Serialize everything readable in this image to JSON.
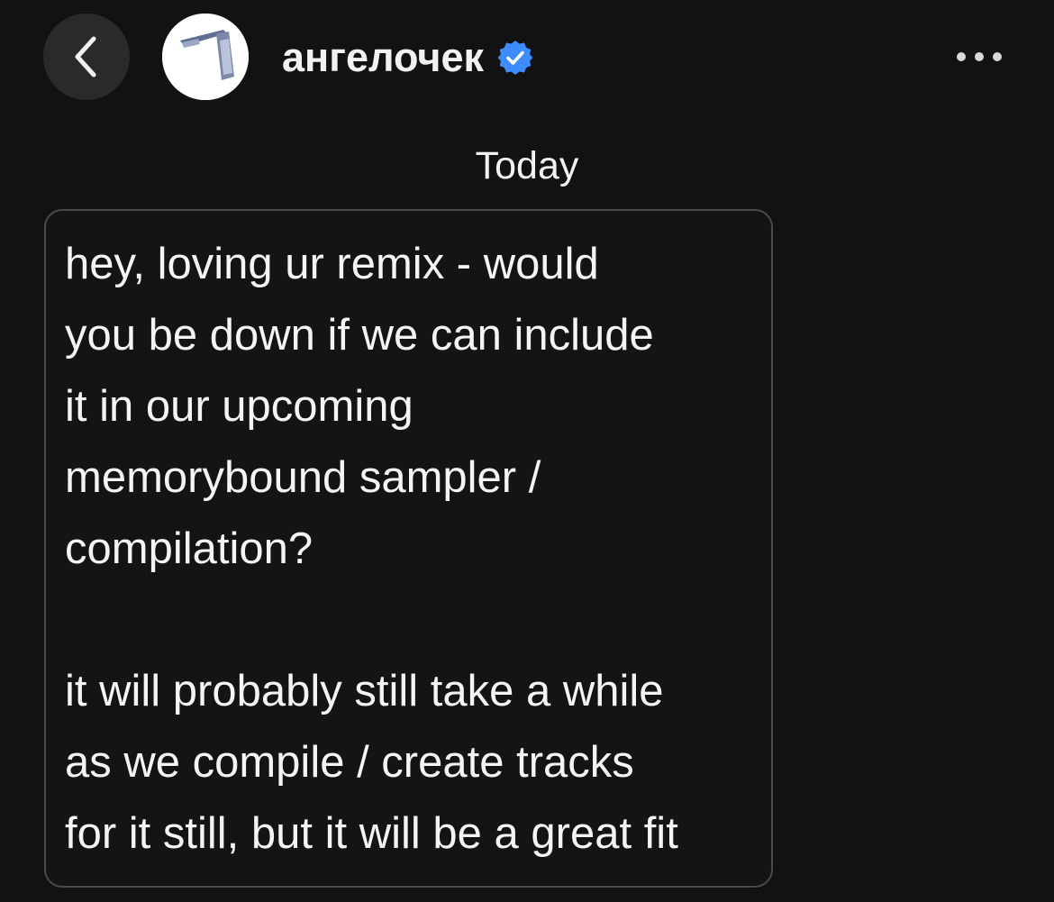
{
  "header": {
    "back_icon": "chevron-left-icon",
    "username": "ангелочек",
    "verified_icon": "verified-badge-icon",
    "more_icon": "more-horizontal-icon",
    "accent_color": "#3d8bfd"
  },
  "conversation": {
    "date_separator": "Today",
    "messages": [
      {
        "lines": [
          "hey, loving ur remix - would",
          "you be down if we can include",
          "it in our upcoming",
          "memorybound sampler /",
          "compilation?",
          "",
          "it will probably still take a while",
          "as we compile / create tracks",
          "for it still, but it will be a great fit"
        ]
      }
    ]
  }
}
